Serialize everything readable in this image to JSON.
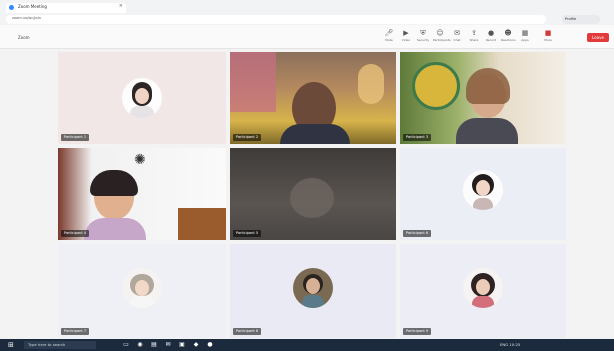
{
  "browser": {
    "tab_title": "Zoom Meeting",
    "url": "zoom.us/wc/join",
    "profile": "Profile"
  },
  "meeting": {
    "label": "Zoom",
    "toolbar": [
      {
        "icon": "mute-icon",
        "label": "Mute"
      },
      {
        "icon": "video-icon",
        "label": "Video"
      },
      {
        "icon": "security-icon",
        "label": "Security"
      },
      {
        "icon": "participants-icon",
        "label": "Participants"
      },
      {
        "icon": "chat-icon",
        "label": "Chat"
      },
      {
        "icon": "share-icon",
        "label": "Share"
      },
      {
        "icon": "record-icon",
        "label": "Record"
      },
      {
        "icon": "reactions-icon",
        "label": "Reactions"
      },
      {
        "icon": "apps-icon",
        "label": "Apps"
      },
      {
        "icon": "more-icon",
        "label": "More"
      }
    ],
    "leave_label": "Leave"
  },
  "participants": [
    {
      "name": "Participant 1"
    },
    {
      "name": "Participant 2"
    },
    {
      "name": "Participant 3"
    },
    {
      "name": "Participant 4"
    },
    {
      "name": "Participant 5"
    },
    {
      "name": "Participant 6"
    },
    {
      "name": "Participant 7"
    },
    {
      "name": "Participant 8"
    },
    {
      "name": "Participant 9"
    }
  ],
  "taskbar": {
    "search_placeholder": "Type here to search",
    "tray_text": "ENG  10:25"
  },
  "colors": {
    "leave": "#e23a3a",
    "taskbar": "#1b2a3c",
    "toolbar_bg": "#fafafa"
  }
}
